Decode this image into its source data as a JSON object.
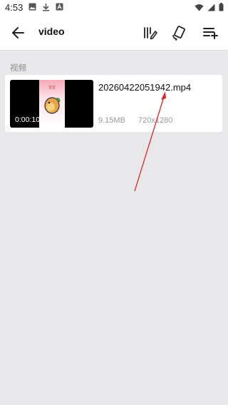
{
  "status_bar": {
    "time": "4:53"
  },
  "toolbar": {
    "title": "video",
    "icons": [
      "back-arrow-icon",
      "edit-list-icon",
      "rotate-icon",
      "playlist-add-icon"
    ]
  },
  "section": {
    "label": "视频"
  },
  "video_item": {
    "thumbnail_caption": "宝宝",
    "duration": "0:00:10",
    "file_name": "20260422051942.mp4",
    "size": "9.15MB",
    "resolution": "720x1280"
  },
  "colors": {
    "background": "#e8e8ea",
    "surface": "#ffffff",
    "annotation_arrow": "#d62828"
  }
}
